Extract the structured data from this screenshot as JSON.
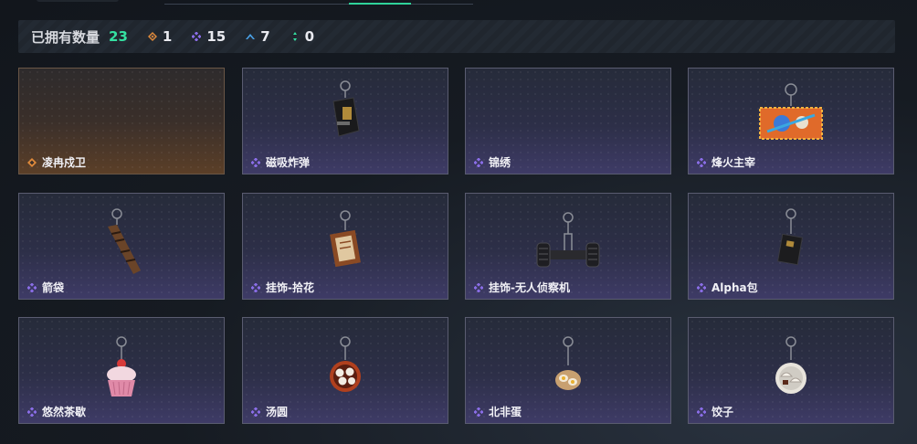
{
  "summary": {
    "owned_label": "已拥有数量",
    "owned_total": "23",
    "stats": [
      {
        "icon": "orange-diamond-icon",
        "value": "1",
        "color": "#e08a3a"
      },
      {
        "icon": "purple-diamond-icon",
        "value": "15",
        "color": "#8b6ee8"
      },
      {
        "icon": "blue-chevron-icon",
        "value": "7",
        "color": "#4aa2e8"
      },
      {
        "icon": "green-dots-icon",
        "value": "0",
        "color": "#35e0a1"
      }
    ]
  },
  "items": [
    {
      "name": "凌冉戍卫",
      "rarity": "orange",
      "icon": "empty"
    },
    {
      "name": "磁吸炸弹",
      "rarity": "purple",
      "icon": "bomb-keychain-icon"
    },
    {
      "name": "锦绣",
      "rarity": "purple",
      "icon": "empty"
    },
    {
      "name": "烽火主宰",
      "rarity": "purple",
      "icon": "banner-keychain-icon"
    },
    {
      "name": "箭袋",
      "rarity": "purple",
      "icon": "quiver-keychain-icon"
    },
    {
      "name": "挂饰-拾花",
      "rarity": "purple",
      "icon": "scroll-keychain-icon"
    },
    {
      "name": "挂饰-无人侦察机",
      "rarity": "purple",
      "icon": "drone-keychain-icon"
    },
    {
      "name": "Alpha包",
      "rarity": "purple",
      "icon": "alpha-pack-keychain-icon"
    },
    {
      "name": "悠然茶歇",
      "rarity": "purple",
      "icon": "cupcake-keychain-icon"
    },
    {
      "name": "汤圆",
      "rarity": "purple",
      "icon": "tangyuan-keychain-icon"
    },
    {
      "name": "北非蛋",
      "rarity": "purple",
      "icon": "shakshuka-keychain-icon"
    },
    {
      "name": "饺子",
      "rarity": "purple",
      "icon": "dumpling-keychain-icon"
    }
  ],
  "colors": {
    "accent_green": "#35e0a1",
    "purple": "#8b6ee8",
    "orange": "#e08a3a",
    "blue": "#4aa2e8"
  }
}
